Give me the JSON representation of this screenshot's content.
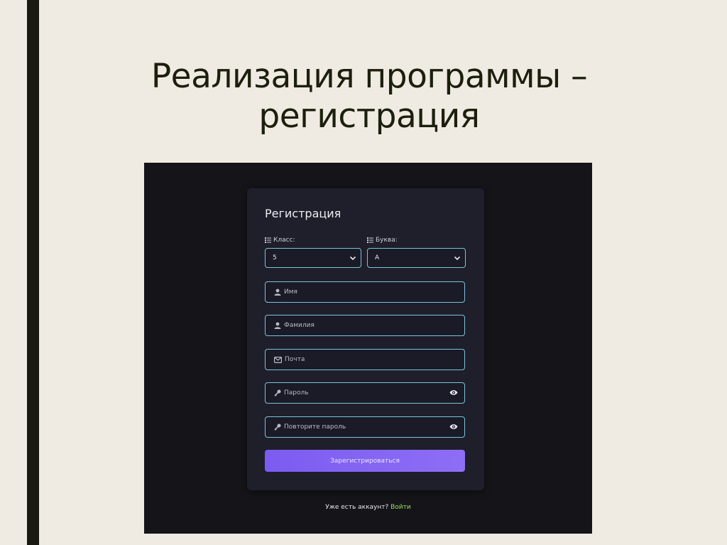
{
  "slide": {
    "title_line1": "Реализация программы –",
    "title_line2": "регистрация"
  },
  "form": {
    "title": "Регистрация",
    "class_label": "Класс:",
    "class_value": "5",
    "letter_label": "Буква:",
    "letter_value": "А",
    "name_placeholder": "Имя",
    "surname_placeholder": "Фамилия",
    "email_placeholder": "Почта",
    "password_placeholder": "Пароль",
    "password_repeat_placeholder": "Повторите пароль",
    "submit_label": "Зарегистрироваться",
    "login_prompt": "Уже есть аккаунт?",
    "login_link": "Войти"
  },
  "colors": {
    "accent": "#7b5cf0",
    "field_border": "#7cc4d8",
    "link": "#9be05c",
    "card_bg": "#1e1f2b",
    "screen_bg": "#141419"
  },
  "icons": {
    "list": "list-icon",
    "user": "user-icon",
    "mail": "mail-icon",
    "key": "key-icon",
    "eye": "eye-icon",
    "chevron": "chevron-down-icon"
  }
}
